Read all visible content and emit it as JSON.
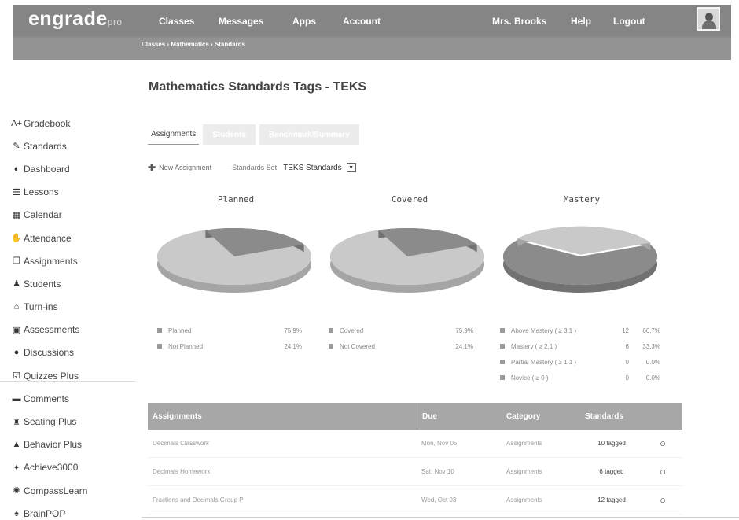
{
  "app": {
    "logo": "engrade",
    "logo_suffix": "pro"
  },
  "nav": {
    "left": [
      "Classes",
      "Messages",
      "Apps",
      "Account"
    ],
    "right": [
      "Mrs. Brooks",
      "Help",
      "Logout"
    ]
  },
  "breadcrumb": "Classes › Mathematics › Standards",
  "page_title": "Mathematics Standards Tags - TEKS",
  "sidebar": {
    "items": [
      {
        "icon": "gradebook-icon",
        "glyph": "A+",
        "label": "Gradebook"
      },
      {
        "icon": "standards-icon",
        "glyph": "✎",
        "label": "Standards"
      },
      {
        "icon": "dashboard-icon",
        "glyph": "◐",
        "label": "Dashboard"
      },
      {
        "icon": "lessons-icon",
        "glyph": "☰",
        "label": "Lessons"
      },
      {
        "icon": "calendar-icon",
        "glyph": "▦",
        "label": "Calendar"
      },
      {
        "icon": "attendance-icon",
        "glyph": "✋",
        "label": "Attendance"
      },
      {
        "icon": "assignments-icon",
        "glyph": "❐",
        "label": "Assignments"
      },
      {
        "icon": "students-icon",
        "glyph": "♟",
        "label": "Students"
      },
      {
        "icon": "turnins-icon",
        "glyph": "⌂",
        "label": "Turn-ins"
      },
      {
        "icon": "assessments-icon",
        "glyph": "▣",
        "label": "Assessments"
      },
      {
        "icon": "discussions-icon",
        "glyph": "●",
        "label": "Discussions"
      },
      {
        "icon": "quizzes-icon",
        "glyph": "☑",
        "label": "Quizzes Plus"
      },
      {
        "icon": "comments-icon",
        "glyph": "▬",
        "label": "Comments"
      },
      {
        "icon": "seating-icon",
        "glyph": "♜",
        "label": "Seating Plus"
      },
      {
        "icon": "behavior-icon",
        "glyph": "▲",
        "label": "Behavior Plus"
      },
      {
        "icon": "achieve-icon",
        "glyph": "✦",
        "label": "Achieve3000"
      },
      {
        "icon": "compasslearn-icon",
        "glyph": "✺",
        "label": "CompassLearn"
      },
      {
        "icon": "brainpop-icon",
        "glyph": "♠",
        "label": "BrainPOP"
      }
    ]
  },
  "tabs": [
    "Assignments",
    "Students",
    "Benchmark/Summary"
  ],
  "toolbar": {
    "new_assignment": "New Assignment",
    "standards_set_label": "Standards Set",
    "standards_set_value": "TEKS Standards"
  },
  "colors": {
    "pie_light": "#c9c9c9",
    "pie_dark": "#8b8b8b",
    "table_header": "#a7a7a7"
  },
  "chart_data": [
    {
      "type": "pie",
      "title": "Planned",
      "labels": [
        "Planned",
        "Not Planned"
      ],
      "values": [
        75.9,
        24.1
      ],
      "value_labels": [
        "75.9%",
        "24.1%"
      ]
    },
    {
      "type": "pie",
      "title": "Covered",
      "labels": [
        "Covered",
        "Not Covered"
      ],
      "values": [
        75.9,
        24.1
      ],
      "value_labels": [
        "75.9%",
        "24.1%"
      ]
    },
    {
      "type": "pie",
      "title": "Mastery",
      "labels": [
        "Above Mastery ( ≥ 3.1 )",
        "Mastery ( ≥ 2.1 )",
        "Partial Mastery ( ≥ 1.1 )",
        "Novice ( ≥ 0 )"
      ],
      "counts": [
        "12",
        "6",
        "0",
        "0"
      ],
      "values": [
        66.7,
        33.3,
        0.0,
        0.0
      ],
      "value_labels": [
        "66.7%",
        "33.3%",
        "0.0%",
        "0.0%"
      ]
    }
  ],
  "table": {
    "headers": [
      "Assignments",
      "Due",
      "Category",
      "Standards"
    ],
    "rows": [
      {
        "name": "Decimals Classwork",
        "due": "Mon, Nov 05",
        "category": "Assignments",
        "standards": "10 tagged"
      },
      {
        "name": "Decimals Homework",
        "due": "Sat, Nov 10",
        "category": "Assignments",
        "standards": "6 tagged"
      },
      {
        "name": "Fractions and Decimals Group P",
        "due": "Wed, Oct 03",
        "category": "Assignments",
        "standards": "12 tagged"
      }
    ]
  }
}
